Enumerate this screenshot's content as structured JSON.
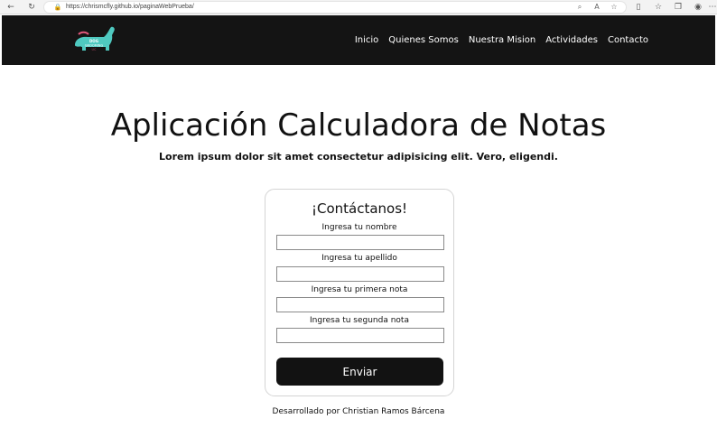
{
  "browser": {
    "url": "https://chrismcfly.github.io/paginaWebPrueba/",
    "icons": {
      "back": "arrow-left-icon",
      "refresh": "refresh-icon",
      "lock": "lock-icon",
      "zoom": "zoom-icon",
      "read_aloud": "read-aloud-icon",
      "favorite": "star-icon",
      "split": "split-screen-icon",
      "favorites": "favorites-icon",
      "collections": "collections-icon",
      "profile": "profile-icon",
      "menu": "more-icon"
    }
  },
  "site": {
    "logo_text": "DOG GROOMING",
    "nav": {
      "items": [
        {
          "label": "Inicio"
        },
        {
          "label": "Quienes Somos"
        },
        {
          "label": "Nuestra Mision"
        },
        {
          "label": "Actividades"
        },
        {
          "label": "Contacto"
        }
      ]
    },
    "colors": {
      "nav_bg": "#141414",
      "logo_teal": "#4fc9c0",
      "logo_accent": "#e0577a",
      "button_bg": "#121212"
    }
  },
  "main": {
    "title": "Aplicación Calculadora de Notas",
    "subtitle": "Lorem ipsum dolor sit amet consectetur adipisicing elit. Vero, eligendi."
  },
  "form": {
    "title": "¡Contáctanos!",
    "fields": [
      {
        "label": "Ingresa tu nombre",
        "value": ""
      },
      {
        "label": "Ingresa tu apellido",
        "value": ""
      },
      {
        "label": "Ingresa tu primera nota",
        "value": ""
      },
      {
        "label": "Ingresa tu segunda nota",
        "value": ""
      }
    ],
    "submit_label": "Enviar"
  },
  "footer": {
    "text": "Desarrollado por Christian Ramos Bárcena"
  }
}
